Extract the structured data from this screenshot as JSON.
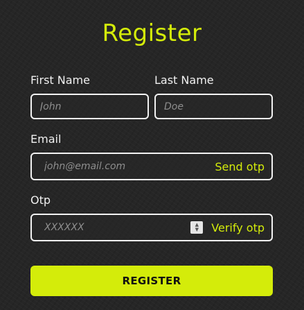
{
  "form": {
    "title": "Register",
    "first_name": {
      "label": "First Name",
      "placeholder": "John",
      "value": ""
    },
    "last_name": {
      "label": "Last Name",
      "placeholder": "Doe",
      "value": ""
    },
    "email": {
      "label": "Email",
      "placeholder": "john@email.com",
      "value": "",
      "action_label": "Send otp"
    },
    "otp": {
      "label": "Otp",
      "placeholder": "XXXXXX",
      "value": "",
      "action_label": "Verify otp",
      "stepper_icon": "spin-arrows-icon"
    },
    "submit_label": "REGISTER"
  },
  "colors": {
    "accent": "#d4ec0a",
    "background": "#262626",
    "field_border": "#f2f2f2",
    "label_text": "#f0f0f0",
    "placeholder_text": "#8e8e8e"
  }
}
